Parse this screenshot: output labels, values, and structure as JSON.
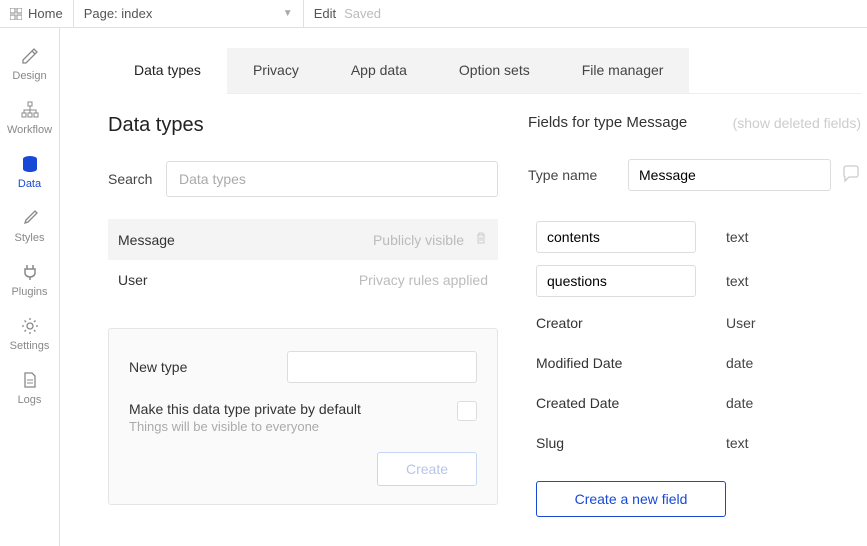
{
  "topbar": {
    "home": "Home",
    "page_label": "Page: index",
    "edit": "Edit",
    "saved": "Saved"
  },
  "sidebar": {
    "items": [
      {
        "label": "Design"
      },
      {
        "label": "Workflow"
      },
      {
        "label": "Data"
      },
      {
        "label": "Styles"
      },
      {
        "label": "Plugins"
      },
      {
        "label": "Settings"
      },
      {
        "label": "Logs"
      }
    ]
  },
  "tabs": [
    {
      "label": "Data types"
    },
    {
      "label": "Privacy"
    },
    {
      "label": "App data"
    },
    {
      "label": "Option sets"
    },
    {
      "label": "File manager"
    }
  ],
  "page": {
    "title": "Data types",
    "search_label": "Search",
    "search_placeholder": "Data types"
  },
  "types": [
    {
      "name": "Message",
      "status": "Publicly visible",
      "selected": true
    },
    {
      "name": "User",
      "status": "Privacy rules applied",
      "selected": false
    }
  ],
  "new_type": {
    "label": "New type",
    "private_label": "Make this data type private by default",
    "private_hint": "Things will be visible to everyone",
    "create": "Create"
  },
  "fields_panel": {
    "title_prefix": "Fields for type",
    "type": "Message",
    "deleted": "(show deleted fields)",
    "type_name_label": "Type name",
    "type_name_value": "Message",
    "fields": [
      {
        "name": "contents",
        "type": "text",
        "editable": true
      },
      {
        "name": "questions",
        "type": "text",
        "editable": true
      },
      {
        "name": "Creator",
        "type": "User",
        "editable": false
      },
      {
        "name": "Modified Date",
        "type": "date",
        "editable": false
      },
      {
        "name": "Created Date",
        "type": "date",
        "editable": false
      },
      {
        "name": "Slug",
        "type": "text",
        "editable": false
      }
    ],
    "new_field": "Create a new field"
  }
}
